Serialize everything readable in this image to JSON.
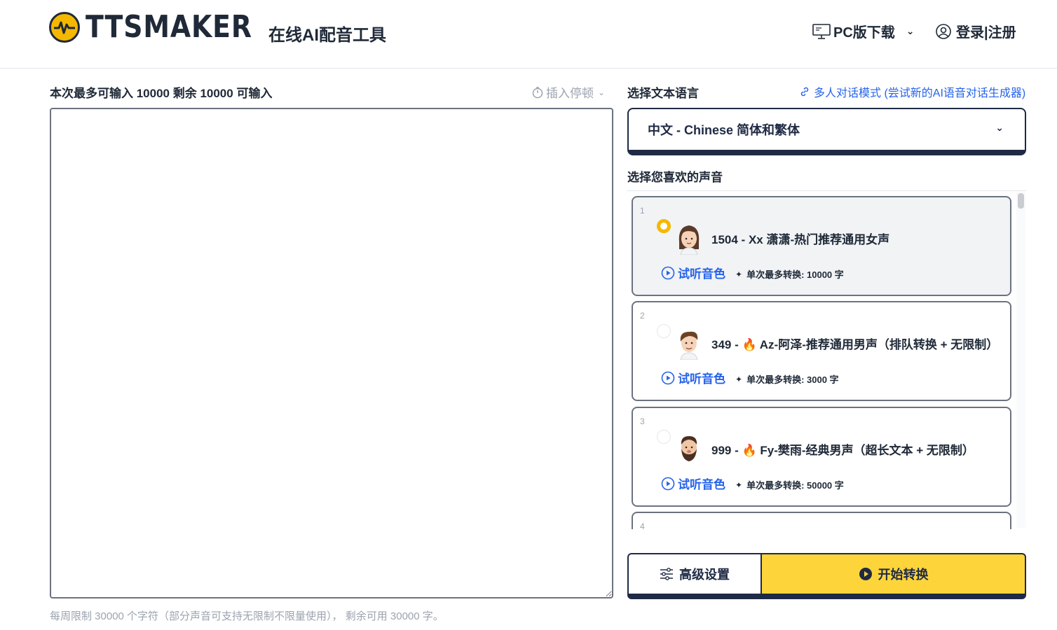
{
  "header": {
    "logo_text": "TTSMAKER",
    "tagline": "在线AI配音工具",
    "pc_download": "PC版下载",
    "login": "登录|注册"
  },
  "editor": {
    "input_limit": "本次最多可输入 10000 剩余 10000 可输入",
    "insert_pause": "插入停顿",
    "text_value": "",
    "weekly_limit": "每周限制 30000 个字符（部分声音可支持无限制不限量使用）， 剩余可用 30000 字。"
  },
  "language": {
    "label": "选择文本语言",
    "multi_mode": "多人对话模式 (尝试新的AI语音对话生成器)",
    "selected": "中文 - Chinese 简体和繁体"
  },
  "voices": {
    "label": "选择您喜欢的声音",
    "items": [
      {
        "num": "1",
        "prefix": "1504 - ",
        "name": "Xx 潇潇-热门推荐通用女声",
        "fire": false,
        "preview": "试听音色",
        "max": "单次最多转换: 10000 字",
        "selected": true,
        "avatar": "female-avatar"
      },
      {
        "num": "2",
        "prefix": "349 - ",
        "name": "Az-阿泽-推荐通用男声（排队转换 + 无限制）",
        "fire": true,
        "preview": "试听音色",
        "max": "单次最多转换: 3000 字",
        "selected": false,
        "avatar": "male-avatar"
      },
      {
        "num": "3",
        "prefix": "999 - ",
        "name": "Fy-樊雨-经典男声（超长文本 + 无限制）",
        "fire": true,
        "preview": "试听音色",
        "max": "单次最多转换: 50000 字",
        "selected": false,
        "avatar": "bearded-male-avatar"
      },
      {
        "num": "4"
      }
    ]
  },
  "actions": {
    "advanced": "高级设置",
    "start": "开始转换"
  },
  "colors": {
    "accent_yellow": "#fdd53b",
    "navy": "#1f2a44",
    "link_blue": "#2563eb"
  }
}
